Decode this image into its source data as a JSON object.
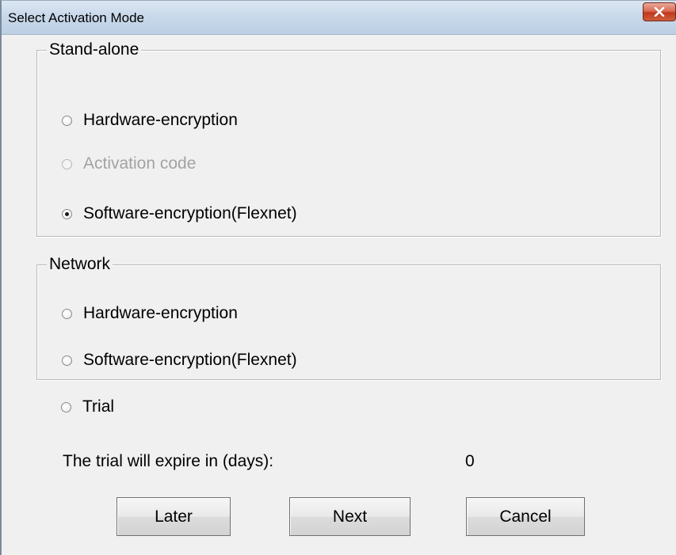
{
  "window": {
    "title": "Select Activation Mode",
    "close_icon": "close-x-icon",
    "close_color": "#c0391e"
  },
  "standalone": {
    "label": "Stand-alone",
    "options": [
      {
        "label": "Hardware-encryption",
        "checked": false,
        "enabled": true
      },
      {
        "label": "Activation code",
        "checked": false,
        "enabled": false
      },
      {
        "label": "Software-encryption(Flexnet)",
        "checked": true,
        "enabled": true
      }
    ]
  },
  "network": {
    "label": "Network",
    "options": [
      {
        "label": "Hardware-encryption",
        "checked": false,
        "enabled": true
      },
      {
        "label": "Software-encryption(Flexnet)",
        "checked": false,
        "enabled": true
      }
    ]
  },
  "trial": {
    "label": "Trial",
    "checked": false,
    "expire_label": "The trial will expire in (days):",
    "expire_value": "0"
  },
  "buttons": {
    "later": "Later",
    "next": "Next",
    "cancel": "Cancel"
  }
}
